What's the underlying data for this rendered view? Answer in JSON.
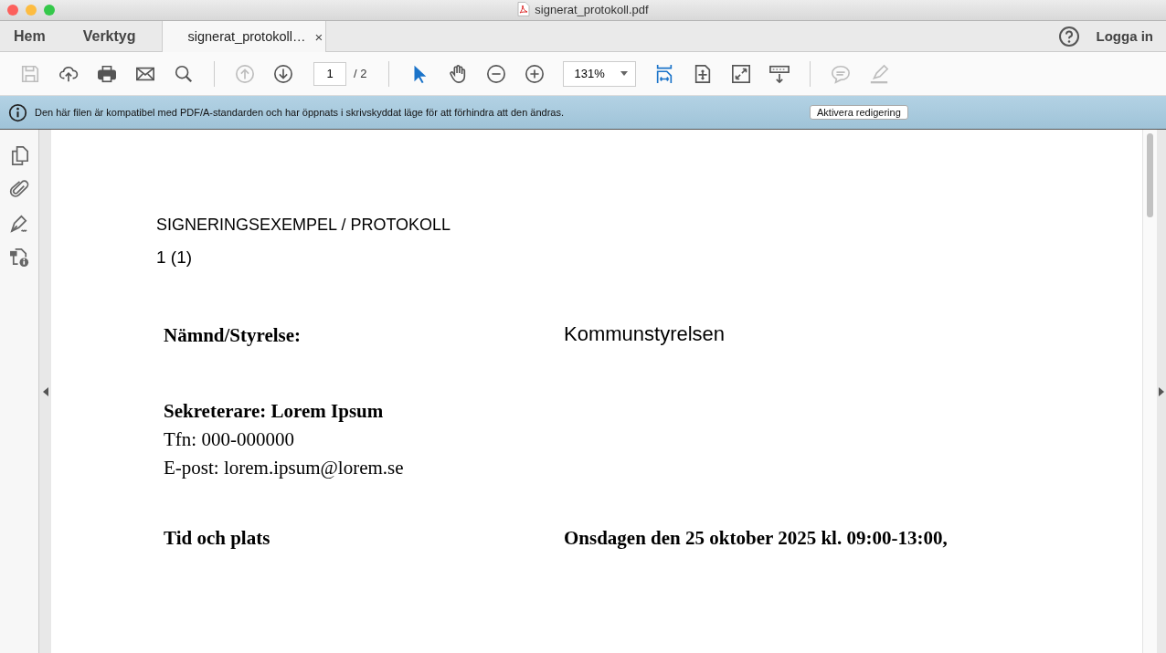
{
  "window": {
    "title": "signerat_protokoll.pdf"
  },
  "nav_tabs": [
    {
      "label": "Hem",
      "selected": false
    },
    {
      "label": "Verktyg",
      "selected": false
    },
    {
      "label": "signerat_protokoll…",
      "selected": true,
      "close": "×"
    }
  ],
  "account": {
    "login": "Logga in"
  },
  "toolbar": [
    {
      "kind": "save",
      "disabled": true
    },
    {
      "kind": "upload",
      "disabled": false
    },
    {
      "kind": "print",
      "disabled": false
    },
    {
      "kind": "mail",
      "disabled": false
    },
    {
      "kind": "search",
      "disabled": false
    },
    {
      "kind": "separator"
    },
    {
      "kind": "up",
      "disabled": true
    },
    {
      "kind": "down",
      "disabled": false
    },
    {
      "kind": "page",
      "value": "1",
      "total": "/ 2"
    },
    {
      "kind": "separator"
    },
    {
      "kind": "pointer",
      "disabled": false,
      "selected": true
    },
    {
      "kind": "hand",
      "disabled": false,
      "selected": false
    },
    {
      "kind": "zoom-out",
      "disabled": false
    },
    {
      "kind": "zoom-in",
      "disabled": false
    },
    {
      "kind": "zoom",
      "value": "131%"
    },
    {
      "kind": "fit",
      "disabled": false,
      "selected": true
    },
    {
      "kind": "page-move",
      "disabled": false,
      "selected": false
    },
    {
      "kind": "fullscreen",
      "disabled": false,
      "selected": false
    },
    {
      "kind": "ruler",
      "disabled": false,
      "selected": false
    },
    {
      "kind": "separator"
    },
    {
      "kind": "comment",
      "disabled": true
    },
    {
      "kind": "highlight",
      "disabled": true
    }
  ],
  "info_bar": {
    "message": "Den här filen är kompatibel med PDF/A-standarden och har öppnats i skrivskyddat läge för att förhindra att den ändras.",
    "button": "Aktivera redigering"
  },
  "sidebar": [
    {
      "kind": "pages"
    },
    {
      "kind": "attachment"
    },
    {
      "kind": "sign"
    },
    {
      "kind": "security"
    }
  ],
  "document": {
    "heading": "SIGNERINGSEXEMPEL / PROTOKOLL",
    "page_number": "1 (1)",
    "blocks": [
      {
        "kind": "field",
        "label": "Nämnd/Styrelse:",
        "value": "Kommunstyrelsen"
      },
      {
        "kind": "contact",
        "title": "Sekreterare: Lorem Ipsum",
        "lines": [
          "Tfn: 000-000000",
          "E-post: lorem.ipsum@lorem.se"
        ]
      },
      {
        "kind": "bold-field",
        "label": "Tid och plats",
        "value": "Onsdagen den 25 oktober 2025 kl. 09:00-13:00,"
      }
    ]
  }
}
